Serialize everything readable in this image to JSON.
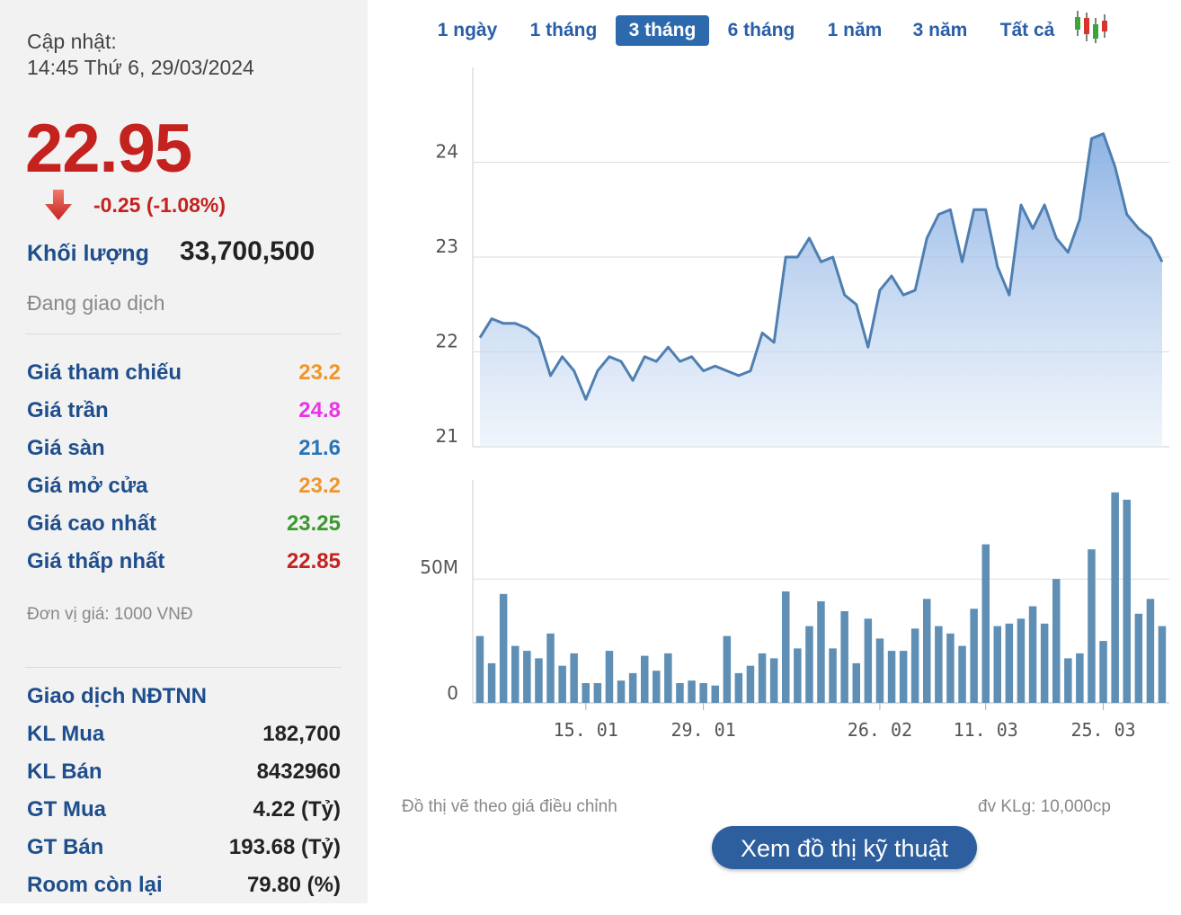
{
  "quote": {
    "update_label": "Cập nhật:",
    "update_time": "14:45 Thứ 6, 29/03/2024",
    "price": "22.95",
    "change": "-0.25 (-1.08%)",
    "volume_label": "Khối lượng",
    "volume": "33,700,500",
    "status": "Đang giao dịch"
  },
  "prices": [
    {
      "label": "Giá tham chiếu",
      "value": "23.2",
      "color": "#f0962b"
    },
    {
      "label": "Giá trần",
      "value": "24.8",
      "color": "#e935e5"
    },
    {
      "label": "Giá sàn",
      "value": "21.6",
      "color": "#2874b8"
    },
    {
      "label": "Giá mở cửa",
      "value": "23.2",
      "color": "#f0962b"
    },
    {
      "label": "Giá cao nhất",
      "value": "23.25",
      "color": "#3a9a2e"
    },
    {
      "label": "Giá thấp nhất",
      "value": "22.85",
      "color": "#c4221f"
    }
  ],
  "unit_note": "Đơn vị giá: 1000 VNĐ",
  "foreign": {
    "title": "Giao dịch NĐTNN",
    "rows": [
      {
        "label": "KL Mua",
        "value": "182,700"
      },
      {
        "label": "KL Bán",
        "value": "8432960"
      },
      {
        "label": "GT Mua",
        "value": "4.22 (Tỷ)"
      },
      {
        "label": "GT Bán",
        "value": "193.68 (Tỷ)"
      },
      {
        "label": "Room còn lại",
        "value": "79.80 (%)"
      }
    ]
  },
  "tabs": [
    "1 ngày",
    "1 tháng",
    "3 tháng",
    "6 tháng",
    "1 năm",
    "3 năm",
    "Tất cả"
  ],
  "active_tab": "3 tháng",
  "colors": {
    "down": "#c4221f",
    "label": "#1f4e8c",
    "line": "#4f7fb1",
    "bar": "#5f8fb5",
    "button": "#2d5e9e"
  },
  "icons": {
    "down": "down-arrow-icon",
    "candles": "candlestick-icon"
  },
  "notes": {
    "left": "Đồ thị vẽ theo giá điều chỉnh",
    "right": "đv KLg: 10,000cp"
  },
  "tech_button": "Xem đồ thị kỹ thuật",
  "chart_data": [
    {
      "type": "area",
      "ylim": [
        21,
        25
      ],
      "yticks": [
        "24",
        "23",
        "22",
        "21"
      ],
      "ytick_values": [
        24,
        23,
        22,
        21
      ],
      "values": [
        22.15,
        22.35,
        22.3,
        22.3,
        22.25,
        22.15,
        21.75,
        21.95,
        21.8,
        21.5,
        21.8,
        21.95,
        21.9,
        21.7,
        21.95,
        21.9,
        22.05,
        21.9,
        21.95,
        21.8,
        21.85,
        21.8,
        21.75,
        21.8,
        22.2,
        22.1,
        23.0,
        23.0,
        23.2,
        22.95,
        23.0,
        22.6,
        22.5,
        22.05,
        22.65,
        22.8,
        22.6,
        22.65,
        23.2,
        23.45,
        23.5,
        22.95,
        23.5,
        23.5,
        22.9,
        22.6,
        23.55,
        23.3,
        23.55,
        23.2,
        23.05,
        23.4,
        24.25,
        24.3,
        23.95,
        23.45,
        23.3,
        23.2,
        22.95
      ],
      "grid": true
    },
    {
      "type": "bar",
      "ylim": [
        0,
        90
      ],
      "yticks": [
        "50M",
        "0"
      ],
      "ytick_values": [
        50,
        0
      ],
      "xticks": [
        "15. 01",
        "29. 01",
        "26. 02",
        "11. 03",
        "25. 03"
      ],
      "xtick_index": [
        9,
        19,
        34,
        43,
        53
      ],
      "values": [
        27,
        16,
        44,
        23,
        21,
        18,
        28,
        15,
        20,
        8,
        8,
        21,
        9,
        12,
        19,
        13,
        20,
        8,
        9,
        8,
        7,
        27,
        12,
        15,
        20,
        18,
        45,
        22,
        31,
        41,
        22,
        37,
        16,
        34,
        26,
        21,
        21,
        30,
        42,
        31,
        28,
        23,
        38,
        64,
        31,
        32,
        34,
        39,
        32,
        50,
        18,
        20,
        62,
        25,
        85,
        82,
        36,
        42,
        31
      ],
      "grid": true
    }
  ]
}
